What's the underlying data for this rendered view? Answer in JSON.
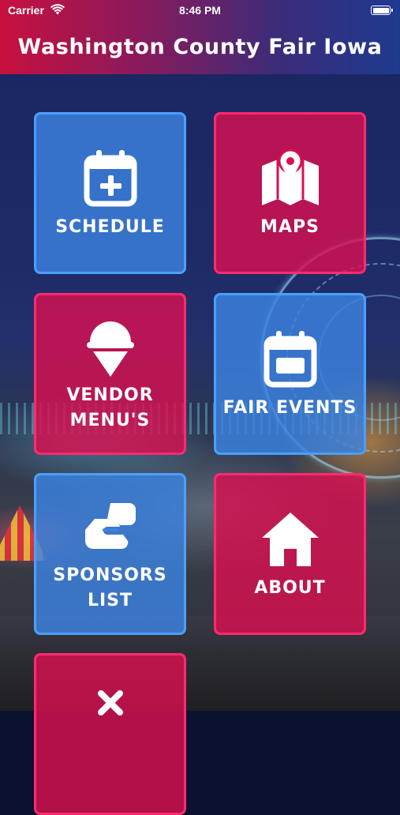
{
  "status_bar": {
    "carrier": "Carrier",
    "time": "8:46 PM"
  },
  "header": {
    "title": "Washington County Fair Iowa"
  },
  "tiles": [
    {
      "label": "SCHEDULE",
      "icon": "calendar-plus-icon",
      "color": "blue"
    },
    {
      "label": "MAPS",
      "icon": "map-pin-icon",
      "color": "red"
    },
    {
      "label": "VENDOR\nMENU'S",
      "icon": "ice-cream-icon",
      "color": "red"
    },
    {
      "label": "FAIR EVENTS",
      "icon": "calendar-icon",
      "color": "blue"
    },
    {
      "label": "SPONSORS\nLIST",
      "icon": "handshake-icon",
      "color": "blue"
    },
    {
      "label": "ABOUT",
      "icon": "home-icon",
      "color": "red"
    },
    {
      "label": "",
      "icon": "close-x-icon",
      "color": "red"
    }
  ],
  "colors": {
    "tile_blue": "#3c82e1",
    "tile_red": "#d81050",
    "header_left": "#c8103f",
    "header_right": "#1e3a8f"
  }
}
